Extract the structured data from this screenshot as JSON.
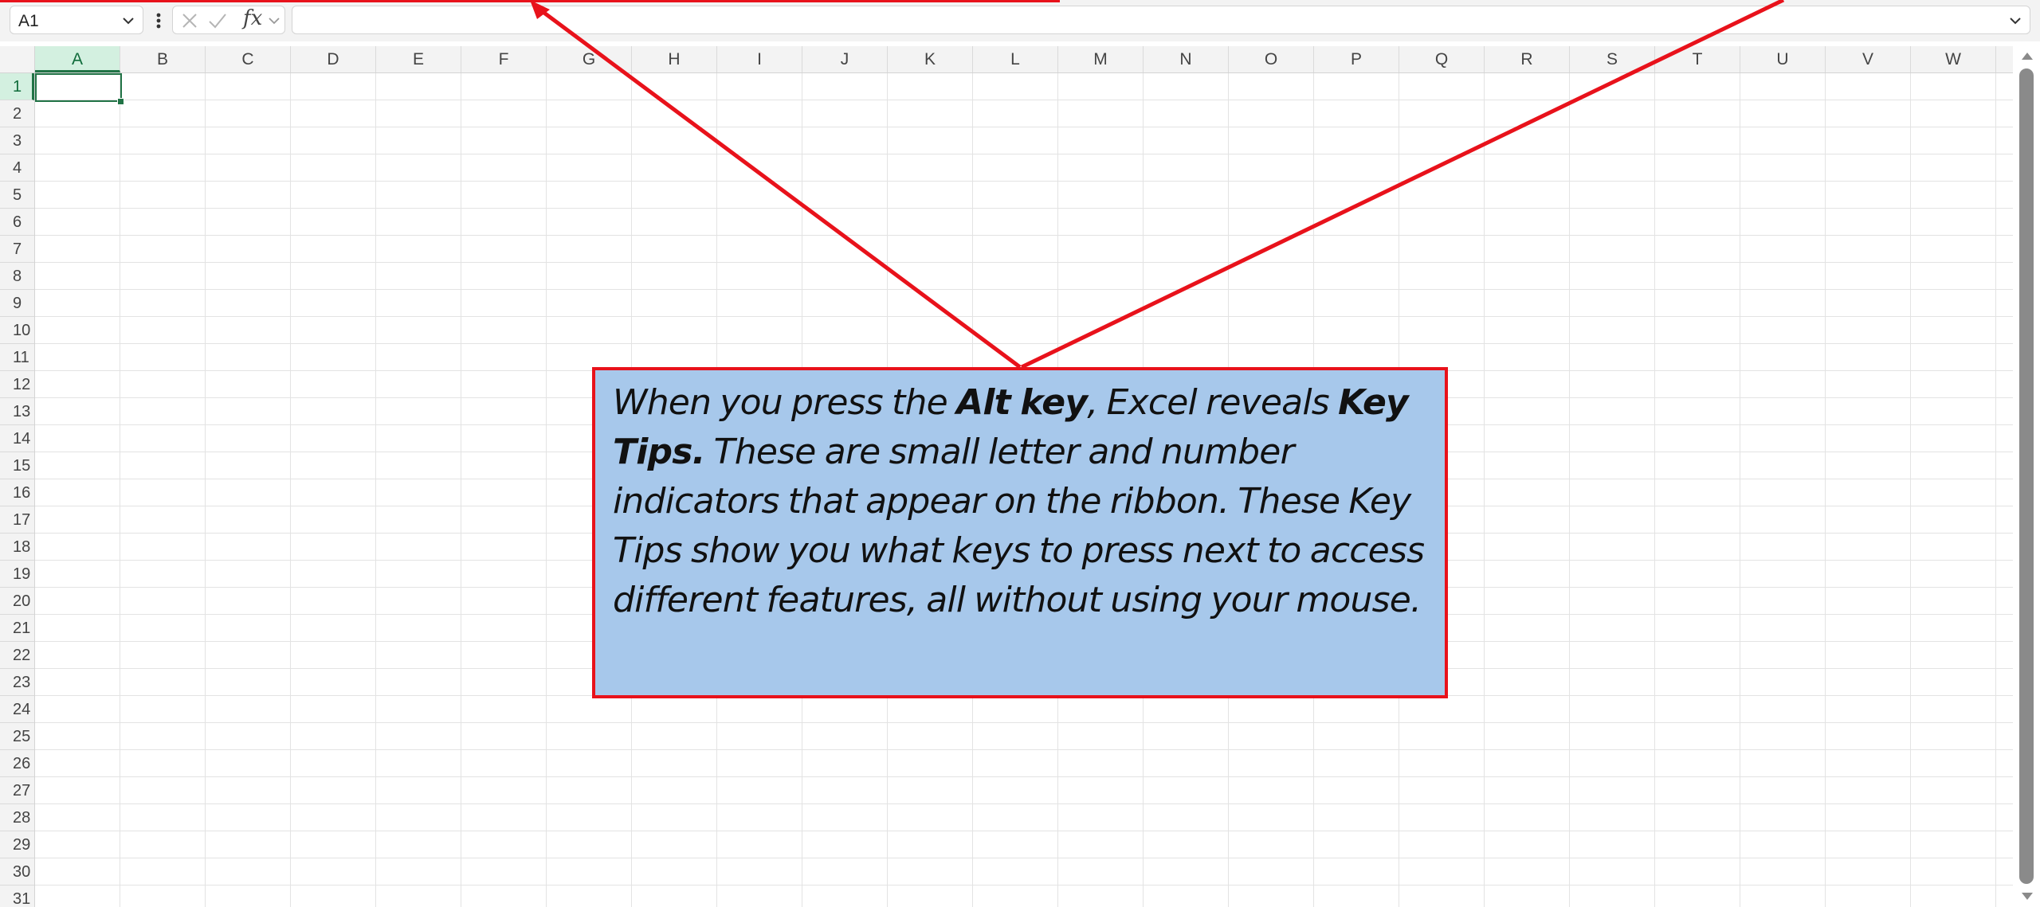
{
  "formula_bar": {
    "name_box_value": "A1",
    "fx_label": "fx",
    "formula_value": ""
  },
  "grid": {
    "columns": [
      "A",
      "B",
      "C",
      "D",
      "E",
      "F",
      "G",
      "H",
      "I",
      "J",
      "K",
      "L",
      "M",
      "N",
      "O",
      "P",
      "Q",
      "R",
      "S",
      "T",
      "U",
      "V",
      "W"
    ],
    "rows": [
      "1",
      "2",
      "3",
      "4",
      "5",
      "6",
      "7",
      "8",
      "9",
      "10",
      "11",
      "12",
      "13",
      "14",
      "15",
      "16",
      "17",
      "18",
      "19",
      "20",
      "21",
      "22",
      "23",
      "24",
      "25",
      "26",
      "27",
      "28",
      "29",
      "30",
      "31"
    ],
    "active_cell": "A1"
  },
  "callout": {
    "part1": "When you press the ",
    "bold1": "Alt key",
    "part2": ", Excel reveals ",
    "bold2": "Key Tips.",
    "part3": " These are small letter and number indicators that appear on the ribbon. These Key Tips show you what keys to press next to access different features, all without using your mouse."
  },
  "colors": {
    "accent_green": "#217346",
    "annotation_red": "#e8121b",
    "callout_fill": "#a7c8eb"
  },
  "icons": [
    "chevron-down-icon",
    "more-options-icon",
    "cancel-icon",
    "enter-icon",
    "fx-icon",
    "scroll-up-icon",
    "scroll-down-icon"
  ]
}
